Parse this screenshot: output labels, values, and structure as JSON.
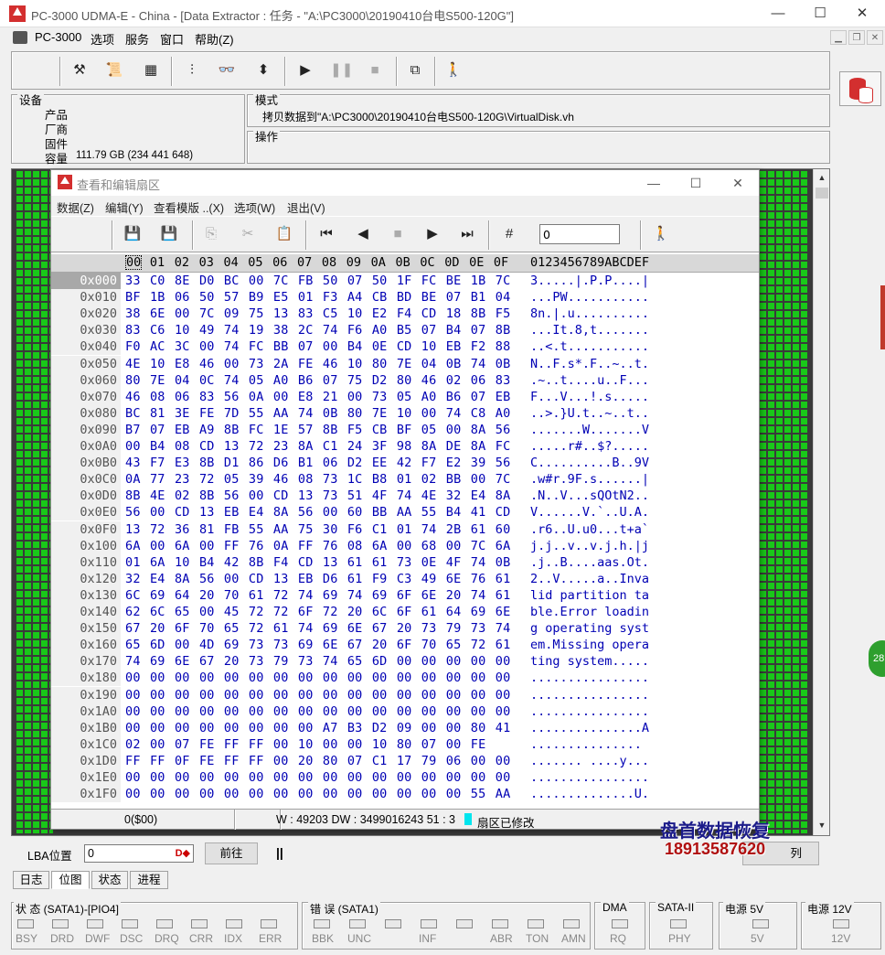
{
  "window": {
    "title": "PC-3000 UDMA-E - China - [Data Extractor : 任务 - \"A:\\PC3000\\20190410台电S500-120G\"]",
    "minimize": "—",
    "maximize": "☐",
    "close": "✕"
  },
  "menubar": {
    "items": [
      "PC-3000",
      "选项",
      "服务",
      "窗口",
      "帮助(Z)"
    ]
  },
  "device_panel": {
    "header": "设备",
    "product_label": "产品",
    "vendor_label": "厂商",
    "firmware_label": "固件",
    "capacity_label": "容量",
    "capacity_value": "111.79 GB (234 441 648)"
  },
  "mode_panel": {
    "header": "模式",
    "value": "拷贝数据到\"A:\\PC3000\\20190410台电S500-120G\\VirtualDisk.vh"
  },
  "operation_panel": {
    "header": "操作"
  },
  "editor": {
    "title": "查看和编辑扇区",
    "menu": [
      "数据(Z)",
      "编辑(Y)",
      "查看模版 ..(X)",
      "选项(W)",
      "退出(V)"
    ],
    "goto_value": "0",
    "hex_header": [
      "00",
      "01",
      "02",
      "03",
      "04",
      "05",
      "06",
      "07",
      "08",
      "09",
      "0A",
      "0B",
      "0C",
      "0D",
      "0E",
      "0F"
    ],
    "ascii_header": "0123456789ABCDEF",
    "rows": [
      {
        "off": "0x000",
        "hex": "33 C0 8E D0 BC 00 7C FB 50 07 50 1F FC BE 1B 7C",
        "ascii": "3.....|.P.P....|"
      },
      {
        "off": "0x010",
        "hex": "BF 1B 06 50 57 B9 E5 01 F3 A4 CB BD BE 07 B1 04",
        "ascii": "...PW..........."
      },
      {
        "off": "0x020",
        "hex": "38 6E 00 7C 09 75 13 83 C5 10 E2 F4 CD 18 8B F5",
        "ascii": "8n.|.u.........."
      },
      {
        "off": "0x030",
        "hex": "83 C6 10 49 74 19 38 2C 74 F6 A0 B5 07 B4 07 8B",
        "ascii": "...It.8,t......."
      },
      {
        "off": "0x040",
        "hex": "F0 AC 3C 00 74 FC BB 07 00 B4 0E CD 10 EB F2 88",
        "ascii": "..<.t..........."
      },
      {
        "off": "0x050",
        "hex": "4E 10 E8 46 00 73 2A FE 46 10 80 7E 04 0B 74 0B",
        "ascii": "N..F.s*.F..~..t."
      },
      {
        "off": "0x060",
        "hex": "80 7E 04 0C 74 05 A0 B6 07 75 D2 80 46 02 06 83",
        "ascii": ".~..t....u..F..."
      },
      {
        "off": "0x070",
        "hex": "46 08 06 83 56 0A 00 E8 21 00 73 05 A0 B6 07 EB",
        "ascii": "F...V...!.s....."
      },
      {
        "off": "0x080",
        "hex": "BC 81 3E FE 7D 55 AA 74 0B 80 7E 10 00 74 C8 A0",
        "ascii": "..>.}U.t..~..t.."
      },
      {
        "off": "0x090",
        "hex": "B7 07 EB A9 8B FC 1E 57 8B F5 CB BF 05 00 8A 56",
        "ascii": ".......W.......V"
      },
      {
        "off": "0x0A0",
        "hex": "00 B4 08 CD 13 72 23 8A C1 24 3F 98 8A DE 8A FC",
        "ascii": ".....r#..$?....."
      },
      {
        "off": "0x0B0",
        "hex": "43 F7 E3 8B D1 86 D6 B1 06 D2 EE 42 F7 E2 39 56",
        "ascii": "C..........B..9V"
      },
      {
        "off": "0x0C0",
        "hex": "0A 77 23 72 05 39 46 08 73 1C B8 01 02 BB 00 7C",
        "ascii": ".w#r.9F.s......|"
      },
      {
        "off": "0x0D0",
        "hex": "8B 4E 02 8B 56 00 CD 13 73 51 4F 74 4E 32 E4 8A",
        "ascii": ".N..V...sQOtN2.."
      },
      {
        "off": "0x0E0",
        "hex": "56 00 CD 13 EB E4 8A 56 00 60 BB AA 55 B4 41 CD",
        "ascii": "V......V.`..U.A."
      },
      {
        "off": "0x0F0",
        "hex": "13 72 36 81 FB 55 AA 75 30 F6 C1 01 74 2B 61 60",
        "ascii": ".r6..U.u0...t+a`"
      },
      {
        "off": "0x100",
        "hex": "6A 00 6A 00 FF 76 0A FF 76 08 6A 00 68 00 7C 6A",
        "ascii": "j.j..v..v.j.h.|j"
      },
      {
        "off": "0x110",
        "hex": "01 6A 10 B4 42 8B F4 CD 13 61 61 73 0E 4F 74 0B",
        "ascii": ".j..B....aas.Ot."
      },
      {
        "off": "0x120",
        "hex": "32 E4 8A 56 00 CD 13 EB D6 61 F9 C3 49 6E 76 61",
        "ascii": "2..V.....a..Inva"
      },
      {
        "off": "0x130",
        "hex": "6C 69 64 20 70 61 72 74 69 74 69 6F 6E 20 74 61",
        "ascii": "lid partition ta"
      },
      {
        "off": "0x140",
        "hex": "62 6C 65 00 45 72 72 6F 72 20 6C 6F 61 64 69 6E",
        "ascii": "ble.Error loadin"
      },
      {
        "off": "0x150",
        "hex": "67 20 6F 70 65 72 61 74 69 6E 67 20 73 79 73 74",
        "ascii": "g operating syst"
      },
      {
        "off": "0x160",
        "hex": "65 6D 00 4D 69 73 73 69 6E 67 20 6F 70 65 72 61",
        "ascii": "em.Missing opera"
      },
      {
        "off": "0x170",
        "hex": "74 69 6E 67 20 73 79 73 74 65 6D 00 00 00 00 00",
        "ascii": "ting system....."
      },
      {
        "off": "0x180",
        "hex": "00 00 00 00 00 00 00 00 00 00 00 00 00 00 00 00",
        "ascii": "................"
      },
      {
        "off": "0x190",
        "hex": "00 00 00 00 00 00 00 00 00 00 00 00 00 00 00 00",
        "ascii": "................"
      },
      {
        "off": "0x1A0",
        "hex": "00 00 00 00 00 00 00 00 00 00 00 00 00 00 00 00",
        "ascii": "................"
      },
      {
        "off": "0x1B0",
        "hex": "00 00 00 00 00 00 00 00 A7 B3 D2 09 00 00 80 41",
        "ascii": "...............A"
      },
      {
        "off": "0x1C0",
        "hex": "02 00 07 FE FF FF 00 10 00 00 10 80 07 00 FE",
        "ascii": "..............."
      },
      {
        "off": "0x1D0",
        "hex": "FF FF 0F FE FF FF 00 20 80 07 C1 17 79 06 00 00",
        "ascii": "....... ....y..."
      },
      {
        "off": "0x1E0",
        "hex": "00 00 00 00 00 00 00 00 00 00 00 00 00 00 00 00",
        "ascii": "................"
      },
      {
        "off": "0x1F0",
        "hex": "00 00 00 00 00 00 00 00 00 00 00 00 00 00 55 AA",
        "ascii": "..............U."
      }
    ],
    "status": {
      "position": "0($00)",
      "values": "3 : 51 W : 49203 DW : 3499016243",
      "modified": "扇区已修改"
    }
  },
  "lba_bar": {
    "label": "LBA位置",
    "value": "0",
    "forward_button": "前往",
    "pause_icon": "||",
    "right_button": "列"
  },
  "watermark": {
    "line1": "盘首数据恢复",
    "line2": "18913587620"
  },
  "tabs": [
    "日志",
    "位图",
    "状态",
    "进程"
  ],
  "status_groups": {
    "state_title": "状 态 (SATA1)-[PIO4]",
    "state_leds": [
      "BSY",
      "DRD",
      "DWF",
      "DSC",
      "DRQ",
      "CRR",
      "IDX",
      "ERR"
    ],
    "error_title": "错 误 (SATA1)",
    "error_leds": [
      "BBK",
      "UNC",
      "",
      "INF",
      "",
      "ABR",
      "TON",
      "AMN"
    ],
    "dma_title": "DMA",
    "dma_leds": [
      "RQ"
    ],
    "sata_title": "SATA-II",
    "sata_leds": [
      "PHY"
    ],
    "p5_title": "电源 5V",
    "p5_leds": [
      "5V"
    ],
    "p12_title": "电源 12V",
    "p12_leds": [
      "12V"
    ]
  },
  "side_badge": "28"
}
